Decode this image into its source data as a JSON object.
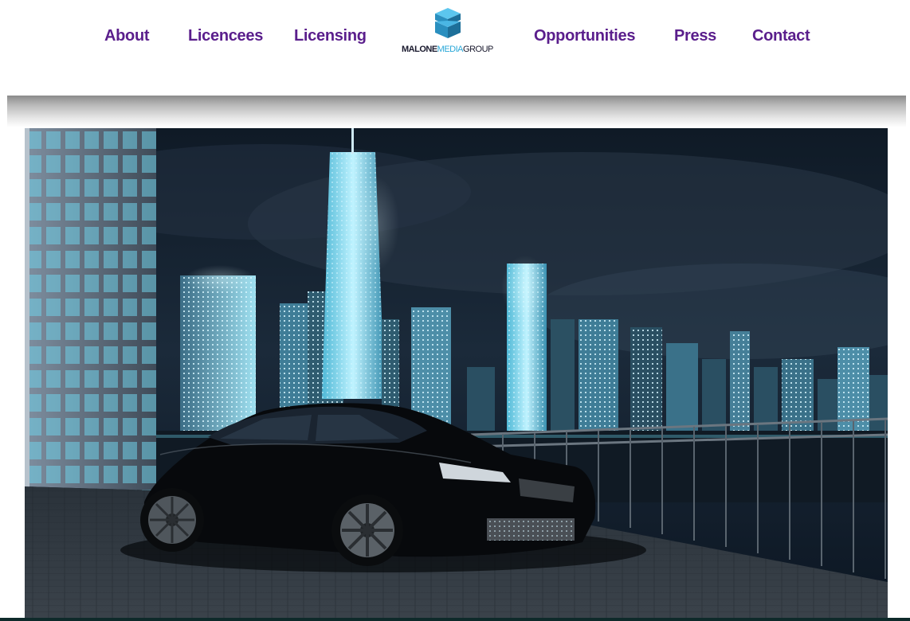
{
  "nav": {
    "about": "About",
    "licencees": "Licencees",
    "licensing": "Licensing",
    "opportunities": "Opportunities",
    "press": "Press",
    "contact": "Contact"
  },
  "logo": {
    "word1": "MALONE",
    "word2": "MEDIA",
    "word3": "GROUP",
    "icon": "stacked-cubes-icon"
  },
  "colors": {
    "nav_text": "#5a1e8c",
    "logo_blue": "#2aa8d8"
  },
  "hero": {
    "description_icon": "car-city-night-photo"
  }
}
